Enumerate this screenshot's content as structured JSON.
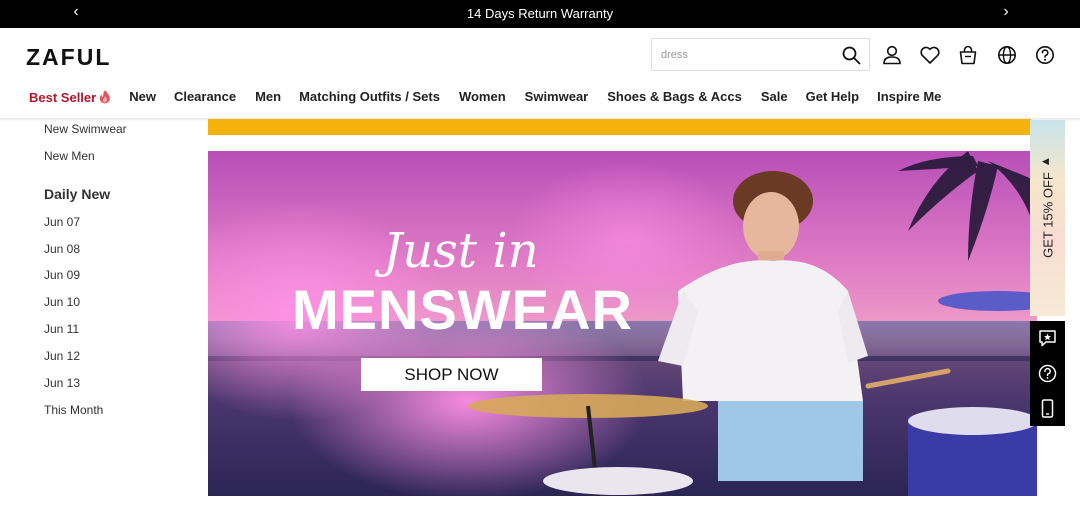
{
  "announcement": {
    "message": "14 Days Return Warranty",
    "prev_icon": "chevron-left-icon",
    "next_icon": "chevron-right-icon"
  },
  "header": {
    "logo": "ZAFUL",
    "search": {
      "placeholder": "dress",
      "icon": "search-icon"
    },
    "icons": [
      "user-icon",
      "heart-icon",
      "bag-icon",
      "globe-icon",
      "help-icon"
    ]
  },
  "nav": {
    "items": [
      {
        "label": "Best Seller",
        "icon": "flame-icon",
        "color": "#b1182b"
      },
      {
        "label": "New"
      },
      {
        "label": "Clearance"
      },
      {
        "label": "Men"
      },
      {
        "label": "Matching Outfits / Sets"
      },
      {
        "label": "Women"
      },
      {
        "label": "Swimwear"
      },
      {
        "label": "Shoes & Bags & Accs"
      },
      {
        "label": "Sale"
      },
      {
        "label": "Get Help"
      },
      {
        "label": "Inspire Me"
      }
    ]
  },
  "sidebar": {
    "top_links": [
      "New Swimwear",
      "New Men"
    ],
    "daily_heading": "Daily New",
    "daily_links": [
      "Jun 07",
      "Jun 08",
      "Jun 09",
      "Jun 10",
      "Jun 11",
      "Jun 12",
      "Jun 13",
      "This Month"
    ]
  },
  "hero": {
    "script_title": "Just in",
    "title": "MENSWEAR",
    "cta": "SHOP NOW"
  },
  "promo_tab": {
    "label": "GET 15% OFF",
    "icon": "caret-left-icon"
  },
  "dock": {
    "icons": [
      "chat-star-icon",
      "help-icon",
      "mobile-icon"
    ]
  },
  "colors": {
    "accent": "#b1182b",
    "banner_yellow": "#f5b20a"
  }
}
